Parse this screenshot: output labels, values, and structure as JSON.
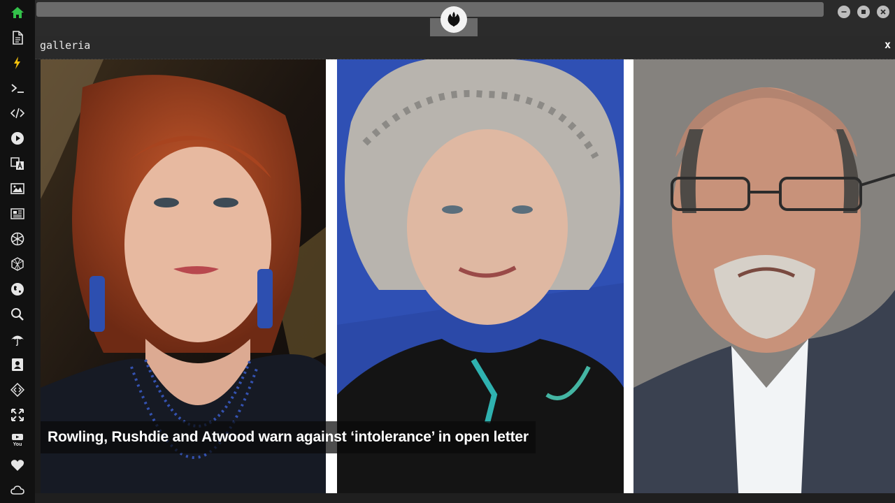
{
  "sidebar": {
    "items": [
      {
        "icon": "home-icon",
        "active": true
      },
      {
        "icon": "document-icon"
      },
      {
        "icon": "lightning-icon"
      },
      {
        "icon": "terminal-icon"
      },
      {
        "icon": "code-icon"
      },
      {
        "icon": "play-icon"
      },
      {
        "icon": "translate-icon"
      },
      {
        "icon": "image-icon"
      },
      {
        "icon": "news-icon"
      },
      {
        "icon": "aperture-icon"
      },
      {
        "icon": "cube-icon"
      },
      {
        "icon": "globe-icon"
      },
      {
        "icon": "search-icon"
      },
      {
        "icon": "umbrella-icon"
      },
      {
        "icon": "contact-icon"
      },
      {
        "icon": "diamond-code-icon"
      },
      {
        "icon": "expand-icon"
      },
      {
        "icon": "youtube-icon"
      },
      {
        "icon": "heart-icon"
      },
      {
        "icon": "cloud-icon"
      }
    ],
    "accent_color": "#33c24a"
  },
  "window": {
    "logo_icon": "rebel-alliance-logo-icon",
    "minimize_icon": "minimize-icon",
    "maximize_icon": "maximize-icon",
    "close_icon": "close-icon"
  },
  "panel": {
    "title": "galleria",
    "close_label": "x"
  },
  "gallery": {
    "caption": "Rowling, Rushdie and Atwood warn against ‘intolerance’ in open letter"
  }
}
